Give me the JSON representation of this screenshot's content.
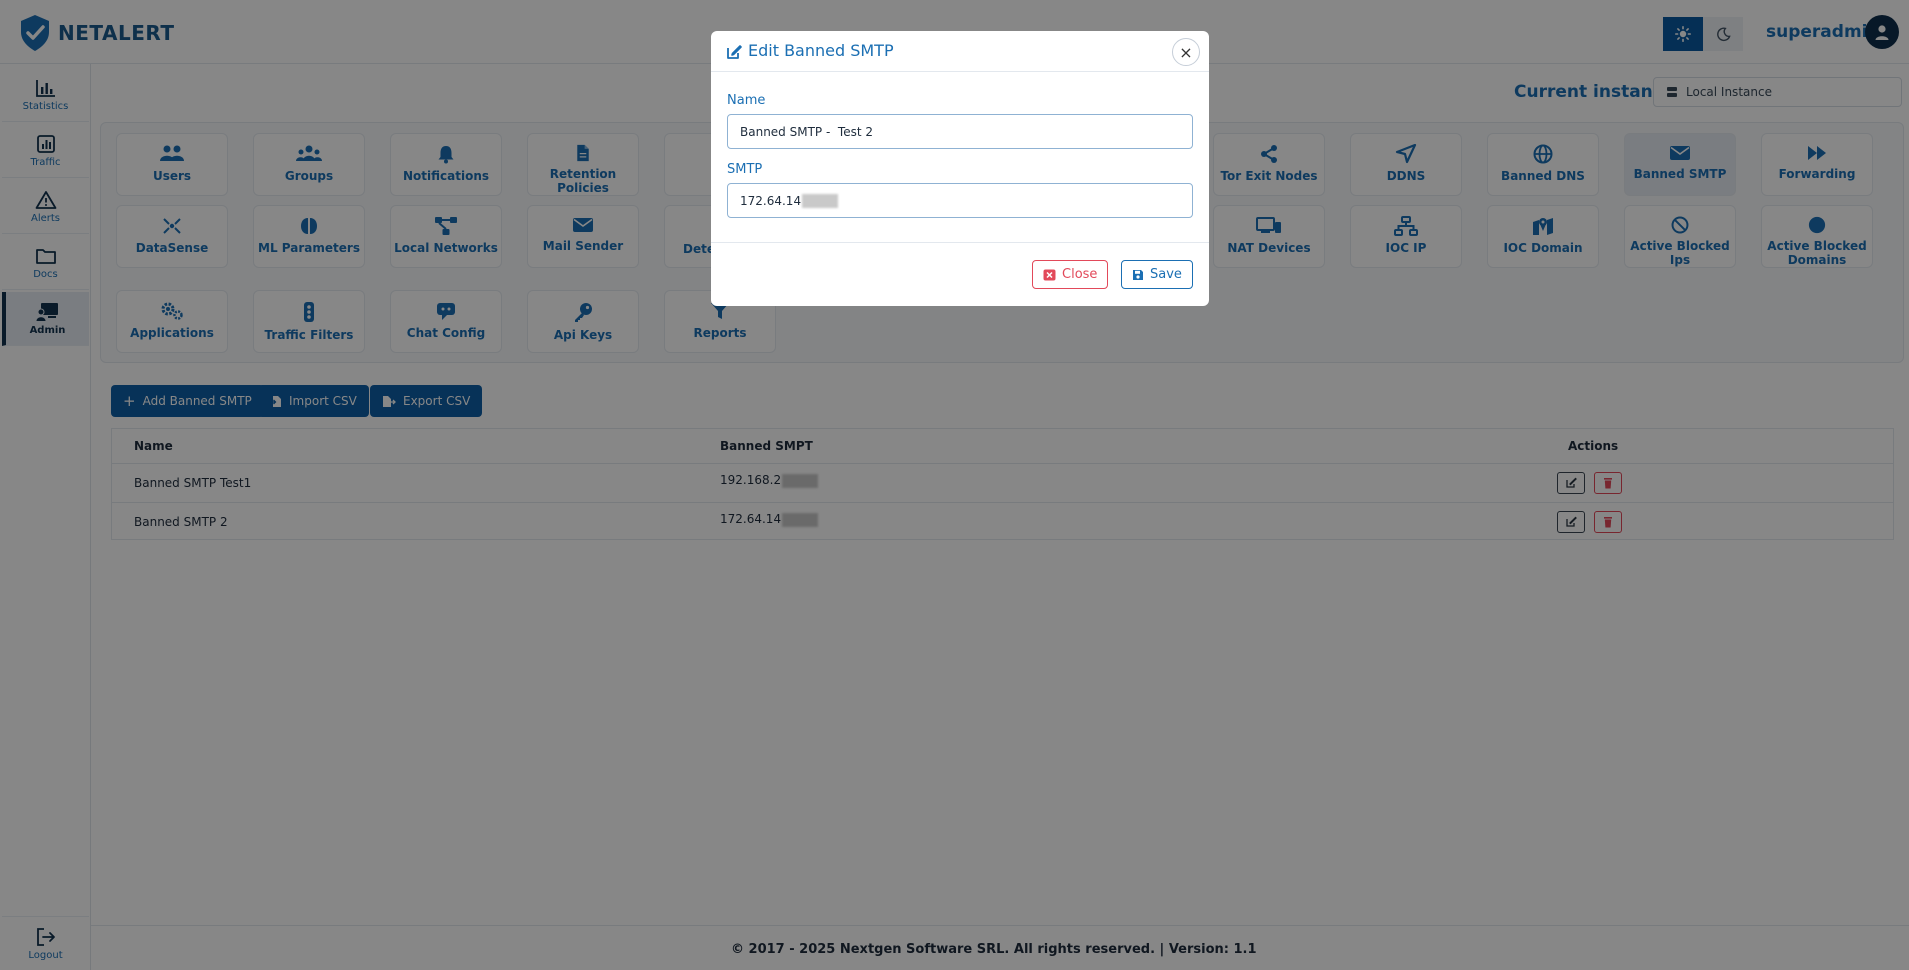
{
  "app": {
    "logo_text": "NETALERT"
  },
  "topbar": {
    "username": "superadmin",
    "theme": {
      "light_icon": "sun-icon",
      "dark_icon": "moon-icon"
    }
  },
  "sidebar": {
    "items": [
      {
        "label": "Statistics",
        "icon": "bar-chart-icon"
      },
      {
        "label": "Traffic",
        "icon": "chart-box-icon"
      },
      {
        "label": "Alerts",
        "icon": "warning-triangle-icon"
      },
      {
        "label": "Docs",
        "icon": "folder-icon"
      },
      {
        "label": "Admin",
        "icon": "admin-screen-icon"
      }
    ],
    "logout": "Logout"
  },
  "instance": {
    "label": "Current instance:",
    "value": "Local Instance"
  },
  "tiles": [
    {
      "label": "Users"
    },
    {
      "label": "Groups"
    },
    {
      "label": "Notifications"
    },
    {
      "label": "Retention Policies"
    },
    {
      "label": "Tor Exit Nodes"
    },
    {
      "label": "DDNS"
    },
    {
      "label": "Banned DNS"
    },
    {
      "label": "Banned SMTP"
    },
    {
      "label": "Forwarding"
    },
    {
      "label": "DataSense"
    },
    {
      "label": "ML Parameters"
    },
    {
      "label": "Local Networks"
    },
    {
      "label": "Mail Sender"
    },
    {
      "label": "Dete"
    },
    {
      "label": "NAT Devices"
    },
    {
      "label": "IOC IP"
    },
    {
      "label": "IOC Domain"
    },
    {
      "label": "Active Blocked Ips"
    },
    {
      "label": "Active Blocked Domains"
    },
    {
      "label": "Applications"
    },
    {
      "label": "Traffic Filters"
    },
    {
      "label": "Chat Config"
    },
    {
      "label": "Api Keys"
    },
    {
      "label": "Reports"
    }
  ],
  "actions": {
    "add": "Add Banned SMTP",
    "import": "Import CSV",
    "export": "Export CSV"
  },
  "table": {
    "headers": {
      "name": "Name",
      "smtp": "Banned SMPT",
      "actions": "Actions"
    },
    "rows": [
      {
        "name": "Banned SMTP Test1",
        "smtp": "192.168.2"
      },
      {
        "name": "Banned SMTP 2",
        "smtp": "172.64.14"
      }
    ]
  },
  "footer": {
    "text": "© 2017 - 2025 Nextgen Software SRL. All rights reserved. | Version: 1.1"
  },
  "modal": {
    "title": "Edit Banned SMTP",
    "name_label": "Name",
    "name_value": "Banned SMTP -  Test 2",
    "smtp_label": "SMTP",
    "smtp_value": "172.64.14",
    "close_label": "Close",
    "save_label": "Save"
  },
  "colors": {
    "primary": "#0f5fa6",
    "accent_text": "#1b6fb3",
    "danger": "#e2495a",
    "navy": "#12324f"
  }
}
